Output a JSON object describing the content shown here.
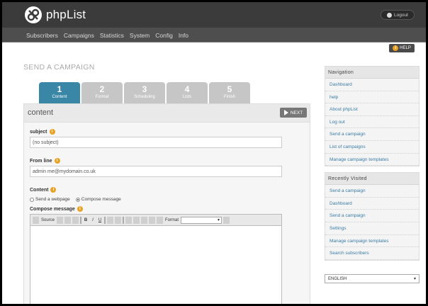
{
  "app": {
    "name": "phpList",
    "logout_label": "Logout",
    "help_label": "HELP"
  },
  "menu": [
    "Subscribers",
    "Campaigns",
    "Statistics",
    "System",
    "Config",
    "Info"
  ],
  "page_title": "SEND A CAMPAIGN",
  "tabs": [
    {
      "num": "1",
      "label": "Content",
      "active": true
    },
    {
      "num": "2",
      "label": "Format",
      "active": false
    },
    {
      "num": "3",
      "label": "Scheduling",
      "active": false
    },
    {
      "num": "4",
      "label": "Lists",
      "active": false
    },
    {
      "num": "5",
      "label": "Finish",
      "active": false
    }
  ],
  "panel": {
    "title": "content",
    "next_label": "NEXT"
  },
  "form": {
    "subject_label": "subject",
    "subject_value": "(no subject)",
    "from_label": "From line",
    "from_value": "admin me@mydomain.co.uk",
    "content_label": "Content",
    "content_options": [
      "Send a webpage",
      "Compose message"
    ],
    "compose_label": "Compose message",
    "toolbar": {
      "source_label": "Source",
      "format_label": "Format"
    }
  },
  "sidebar": {
    "navigation": {
      "title": "Navigation",
      "items": [
        "Dashboard",
        "help",
        "About phpList",
        "Log out",
        "Send a campaign",
        "List of campaigns",
        "Manage campaign templates"
      ]
    },
    "recent": {
      "title": "Recently Visited",
      "items": [
        "Send a campaign",
        "Dashboard",
        "Send a campaign",
        "Settings",
        "Manage campaign templates",
        "Search subscribers"
      ]
    }
  },
  "language": "ENGLISH",
  "colors": {
    "header": "#3b3b3b",
    "active_tab": "#3a86a6",
    "info_icon": "#e8a325",
    "link": "#3a7ca5"
  }
}
